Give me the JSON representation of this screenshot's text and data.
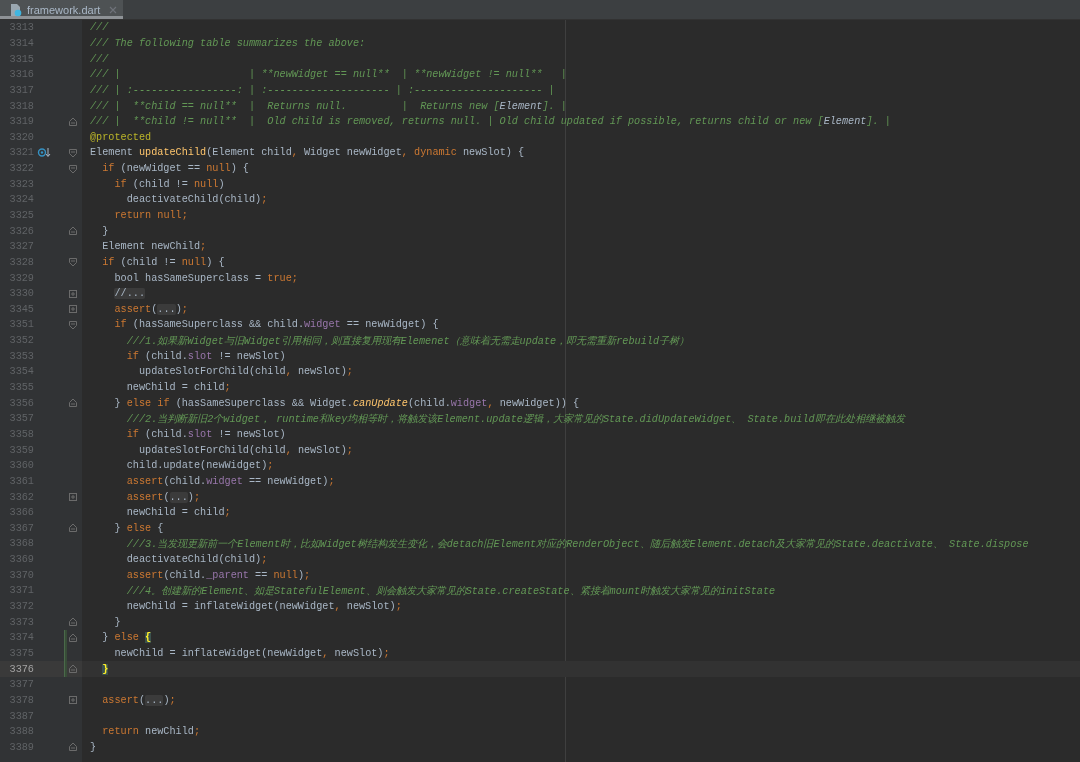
{
  "tabs": [
    {
      "label": "framework.dart",
      "selected": true
    }
  ],
  "lines": [
    {
      "number": "3313",
      "tokens": [
        {
          "kind": "doc",
          "text": "///"
        }
      ]
    },
    {
      "number": "3314",
      "tokens": [
        {
          "kind": "doc",
          "text": "/// The following table summarizes the above:"
        }
      ]
    },
    {
      "number": "3315",
      "tokens": [
        {
          "kind": "doc",
          "text": "///"
        }
      ]
    },
    {
      "number": "3316",
      "tokens": [
        {
          "kind": "doc",
          "text": "/// |                     | **newWidget == null**  | **newWidget != null**   |"
        }
      ]
    },
    {
      "number": "3317",
      "tokens": [
        {
          "kind": "doc",
          "text": "/// | :-----------------: | :-------------------- | :--------------------- |"
        }
      ]
    },
    {
      "number": "3318",
      "tokens": [
        {
          "kind": "doc",
          "text": "/// |  **child == null**  |  Returns null.         |  Returns new ["
        },
        {
          "kind": "ref",
          "text": "Element"
        },
        {
          "kind": "doc",
          "text": "]. |"
        }
      ]
    },
    {
      "number": "3319",
      "fold_end": true,
      "tokens": [
        {
          "kind": "doc",
          "text": "/// |  **child != null**  |  Old child is removed, returns null. | Old child updated if possible, returns child or new ["
        },
        {
          "kind": "ref",
          "text": "Element"
        },
        {
          "kind": "doc",
          "text": "]. |"
        }
      ]
    },
    {
      "number": "3320",
      "tokens": [
        {
          "kind": "meta",
          "text": "@protected"
        }
      ]
    },
    {
      "number": "3321",
      "fold_start": true,
      "override": true,
      "tokens": [
        {
          "kind": "txt",
          "text": "Element "
        },
        {
          "kind": "fn",
          "text": "updateChild"
        },
        {
          "kind": "txt",
          "text": "(Element child"
        },
        {
          "kind": "kw",
          "text": ", "
        },
        {
          "kind": "txt",
          "text": "Widget newWidget"
        },
        {
          "kind": "kw",
          "text": ", dynamic "
        },
        {
          "kind": "txt",
          "text": "newSlot) {"
        }
      ]
    },
    {
      "number": "3322",
      "fold_start": true,
      "tokens": [
        {
          "kind": "kw",
          "text": "  if "
        },
        {
          "kind": "txt",
          "text": "(newWidget == "
        },
        {
          "kind": "kw",
          "text": "null"
        },
        {
          "kind": "txt",
          "text": ") {"
        }
      ]
    },
    {
      "number": "3323",
      "tokens": [
        {
          "kind": "kw",
          "text": "    if "
        },
        {
          "kind": "txt",
          "text": "(child != "
        },
        {
          "kind": "kw",
          "text": "null"
        },
        {
          "kind": "txt",
          "text": ")"
        }
      ]
    },
    {
      "number": "3324",
      "tokens": [
        {
          "kind": "txt",
          "text": "      deactivateChild(child)"
        },
        {
          "kind": "kw",
          "text": ";"
        }
      ]
    },
    {
      "number": "3325",
      "tokens": [
        {
          "kind": "kw",
          "text": "    return null;"
        }
      ]
    },
    {
      "number": "3326",
      "fold_end": true,
      "tokens": [
        {
          "kind": "txt",
          "text": "  }"
        }
      ]
    },
    {
      "number": "3327",
      "tokens": [
        {
          "kind": "txt",
          "text": "  Element newChild"
        },
        {
          "kind": "kw",
          "text": ";"
        }
      ]
    },
    {
      "number": "3328",
      "fold_start": true,
      "tokens": [
        {
          "kind": "kw",
          "text": "  if "
        },
        {
          "kind": "txt",
          "text": "(child != "
        },
        {
          "kind": "kw",
          "text": "null"
        },
        {
          "kind": "txt",
          "text": ") {"
        }
      ]
    },
    {
      "number": "3329",
      "tokens": [
        {
          "kind": "txt",
          "text": "    bool hasSameSuperclass = "
        },
        {
          "kind": "kw",
          "text": "true;"
        }
      ]
    },
    {
      "number": "3330",
      "folded": true,
      "tokens": [
        {
          "kind": "fold",
          "text": "    //..."
        }
      ]
    },
    {
      "number": "3345",
      "folded": true,
      "tokens": [
        {
          "kind": "kw",
          "text": "    assert"
        },
        {
          "kind": "txt",
          "text": "("
        },
        {
          "kind": "fold",
          "text": "..."
        },
        {
          "kind": "txt",
          "text": ")"
        },
        {
          "kind": "kw",
          "text": ";"
        }
      ]
    },
    {
      "number": "3351",
      "fold_start": true,
      "tokens": [
        {
          "kind": "kw",
          "text": "    if "
        },
        {
          "kind": "txt",
          "text": "(hasSameSuperclass && child."
        },
        {
          "kind": "field",
          "text": "widget"
        },
        {
          "kind": "txt",
          "text": " == newWidget) {"
        }
      ]
    },
    {
      "number": "3352",
      "tokens": [
        {
          "kind": "doc",
          "text": "      ///1.如果新Widget与旧Widget引用相同，则直接复用现有Elemenet（意味着无需走update，即无需重新rebuild子树）"
        }
      ]
    },
    {
      "number": "3353",
      "tokens": [
        {
          "kind": "kw",
          "text": "      if "
        },
        {
          "kind": "txt",
          "text": "(child."
        },
        {
          "kind": "field",
          "text": "slot"
        },
        {
          "kind": "txt",
          "text": " != newSlot)"
        }
      ]
    },
    {
      "number": "3354",
      "tokens": [
        {
          "kind": "txt",
          "text": "        updateSlotForChild(child"
        },
        {
          "kind": "kw",
          "text": ", "
        },
        {
          "kind": "txt",
          "text": "newSlot)"
        },
        {
          "kind": "kw",
          "text": ";"
        }
      ]
    },
    {
      "number": "3355",
      "tokens": [
        {
          "kind": "txt",
          "text": "      newChild = child"
        },
        {
          "kind": "kw",
          "text": ";"
        }
      ]
    },
    {
      "number": "3356",
      "fold_end": true,
      "tokens": [
        {
          "kind": "txt",
          "text": "    } "
        },
        {
          "kind": "kw",
          "text": "else if "
        },
        {
          "kind": "txt",
          "text": "(hasSameSuperclass && Widget."
        },
        {
          "kind": "call",
          "text": "canUpdate"
        },
        {
          "kind": "txt",
          "text": "(child."
        },
        {
          "kind": "field",
          "text": "widget"
        },
        {
          "kind": "kw",
          "text": ", "
        },
        {
          "kind": "txt",
          "text": "newWidget)) {"
        }
      ]
    },
    {
      "number": "3357",
      "tokens": [
        {
          "kind": "doc",
          "text": "      ///2.当判断新旧2个widget， runtime和key均相等时，将触发该Element.update逻辑，大家常见的State.didUpdateWidget、 State.build即在此处相继被触发"
        }
      ]
    },
    {
      "number": "3358",
      "tokens": [
        {
          "kind": "kw",
          "text": "      if "
        },
        {
          "kind": "txt",
          "text": "(child."
        },
        {
          "kind": "field",
          "text": "slot"
        },
        {
          "kind": "txt",
          "text": " != newSlot)"
        }
      ]
    },
    {
      "number": "3359",
      "tokens": [
        {
          "kind": "txt",
          "text": "        updateSlotForChild(child"
        },
        {
          "kind": "kw",
          "text": ", "
        },
        {
          "kind": "txt",
          "text": "newSlot)"
        },
        {
          "kind": "kw",
          "text": ";"
        }
      ]
    },
    {
      "number": "3360",
      "tokens": [
        {
          "kind": "txt",
          "text": "      child.update(newWidget)"
        },
        {
          "kind": "kw",
          "text": ";"
        }
      ]
    },
    {
      "number": "3361",
      "tokens": [
        {
          "kind": "kw",
          "text": "      assert"
        },
        {
          "kind": "txt",
          "text": "(child."
        },
        {
          "kind": "field",
          "text": "widget"
        },
        {
          "kind": "txt",
          "text": " == newWidget)"
        },
        {
          "kind": "kw",
          "text": ";"
        }
      ]
    },
    {
      "number": "3362",
      "folded": true,
      "tokens": [
        {
          "kind": "kw",
          "text": "      assert"
        },
        {
          "kind": "txt",
          "text": "("
        },
        {
          "kind": "fold",
          "text": "..."
        },
        {
          "kind": "txt",
          "text": ")"
        },
        {
          "kind": "kw",
          "text": ";"
        }
      ]
    },
    {
      "number": "3366",
      "tokens": [
        {
          "kind": "txt",
          "text": "      newChild = child"
        },
        {
          "kind": "kw",
          "text": ";"
        }
      ]
    },
    {
      "number": "3367",
      "fold_end": true,
      "tokens": [
        {
          "kind": "txt",
          "text": "    } "
        },
        {
          "kind": "kw",
          "text": "else "
        },
        {
          "kind": "txt",
          "text": "{"
        }
      ]
    },
    {
      "number": "3368",
      "tokens": [
        {
          "kind": "doc",
          "text": "      ///3.当发现更新前一个Element时，比如Widget树结构发生变化，会detach旧Element对应的RenderObject、随后触发Element.detach及大家常见的State.deactivate、 State.dispose"
        }
      ]
    },
    {
      "number": "3369",
      "tokens": [
        {
          "kind": "txt",
          "text": "      deactivateChild(child)"
        },
        {
          "kind": "kw",
          "text": ";"
        }
      ]
    },
    {
      "number": "3370",
      "tokens": [
        {
          "kind": "kw",
          "text": "      assert"
        },
        {
          "kind": "txt",
          "text": "(child."
        },
        {
          "kind": "field",
          "text": "_parent"
        },
        {
          "kind": "txt",
          "text": " == "
        },
        {
          "kind": "kw",
          "text": "null"
        },
        {
          "kind": "txt",
          "text": ")"
        },
        {
          "kind": "kw",
          "text": ";"
        }
      ]
    },
    {
      "number": "3371",
      "tokens": [
        {
          "kind": "doc",
          "text": "      ///4。创建新的Element、如是StatefulElement、则会触发大家常见的State.createState、紧接着mount时触发大家常见的initState"
        }
      ]
    },
    {
      "number": "3372",
      "tokens": [
        {
          "kind": "txt",
          "text": "      newChild = inflateWidget(newWidget"
        },
        {
          "kind": "kw",
          "text": ", "
        },
        {
          "kind": "txt",
          "text": "newSlot)"
        },
        {
          "kind": "kw",
          "text": ";"
        }
      ]
    },
    {
      "number": "3373",
      "fold_end": true,
      "tokens": [
        {
          "kind": "txt",
          "text": "    }"
        }
      ]
    },
    {
      "number": "3374",
      "fold_end": true,
      "changed": true,
      "tokens": [
        {
          "kind": "txt",
          "text": "  } "
        },
        {
          "kind": "kw",
          "text": "else "
        },
        {
          "kind": "brace",
          "text": "{"
        }
      ]
    },
    {
      "number": "3375",
      "changed": true,
      "tokens": [
        {
          "kind": "txt",
          "text": "    newChild = inflateWidget(newWidget"
        },
        {
          "kind": "kw",
          "text": ", "
        },
        {
          "kind": "txt",
          "text": "newSlot)"
        },
        {
          "kind": "kw",
          "text": ";"
        }
      ]
    },
    {
      "number": "3376",
      "fold_end": true,
      "changed": true,
      "current": true,
      "tokens": [
        {
          "kind": "brace",
          "text": "  }"
        }
      ]
    },
    {
      "number": "3377"
    },
    {
      "number": "3378",
      "folded": true,
      "tokens": [
        {
          "kind": "kw",
          "text": "  assert"
        },
        {
          "kind": "txt",
          "text": "("
        },
        {
          "kind": "fold",
          "text": "..."
        },
        {
          "kind": "txt",
          "text": ")"
        },
        {
          "kind": "kw",
          "text": ";"
        }
      ]
    },
    {
      "number": "3387"
    },
    {
      "number": "3388",
      "tokens": [
        {
          "kind": "kw",
          "text": "  return "
        },
        {
          "kind": "txt",
          "text": "newChild"
        },
        {
          "kind": "kw",
          "text": ";"
        }
      ]
    },
    {
      "number": "3389",
      "fold_end": true,
      "tokens": [
        {
          "kind": "txt",
          "text": "}"
        }
      ]
    }
  ]
}
